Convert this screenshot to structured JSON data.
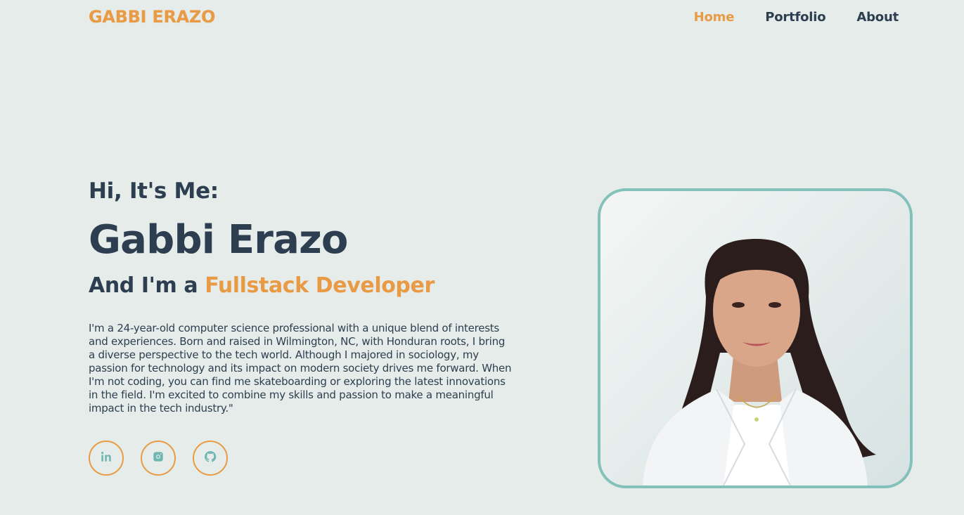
{
  "header": {
    "brand": "GABBI ERAZO",
    "nav": [
      {
        "label": "Home",
        "active": true
      },
      {
        "label": "Portfolio",
        "active": false
      },
      {
        "label": "About",
        "active": false
      }
    ]
  },
  "hero": {
    "greeting": "Hi, It's Me:",
    "name": "Gabbi Erazo",
    "role_prefix": "And I'm a ",
    "role_highlight": "Fullstack Developer",
    "bio": "I'm a 24-year-old computer science professional with a unique blend of interests and experiences. Born and raised in Wilmington, NC, with Honduran roots, I bring a diverse perspective to the tech world. Although I majored in sociology, my passion for technology and its impact on modern society drives me forward. When I'm not coding, you can find me skateboarding or exploring the latest innovations in the field. I'm excited to combine my skills and passion to make a meaningful impact in the tech industry.\""
  },
  "social": [
    {
      "icon": "linkedin-icon"
    },
    {
      "icon": "instagram-icon"
    },
    {
      "icon": "github-icon"
    }
  ],
  "photo": {
    "alt": "Portrait of Gabbi Erazo"
  },
  "colors": {
    "background": "#e6ece9",
    "accent": "#e99a45",
    "text": "#2c3e50",
    "frame": "#84c1bb",
    "icon": "#6fb6b0"
  }
}
